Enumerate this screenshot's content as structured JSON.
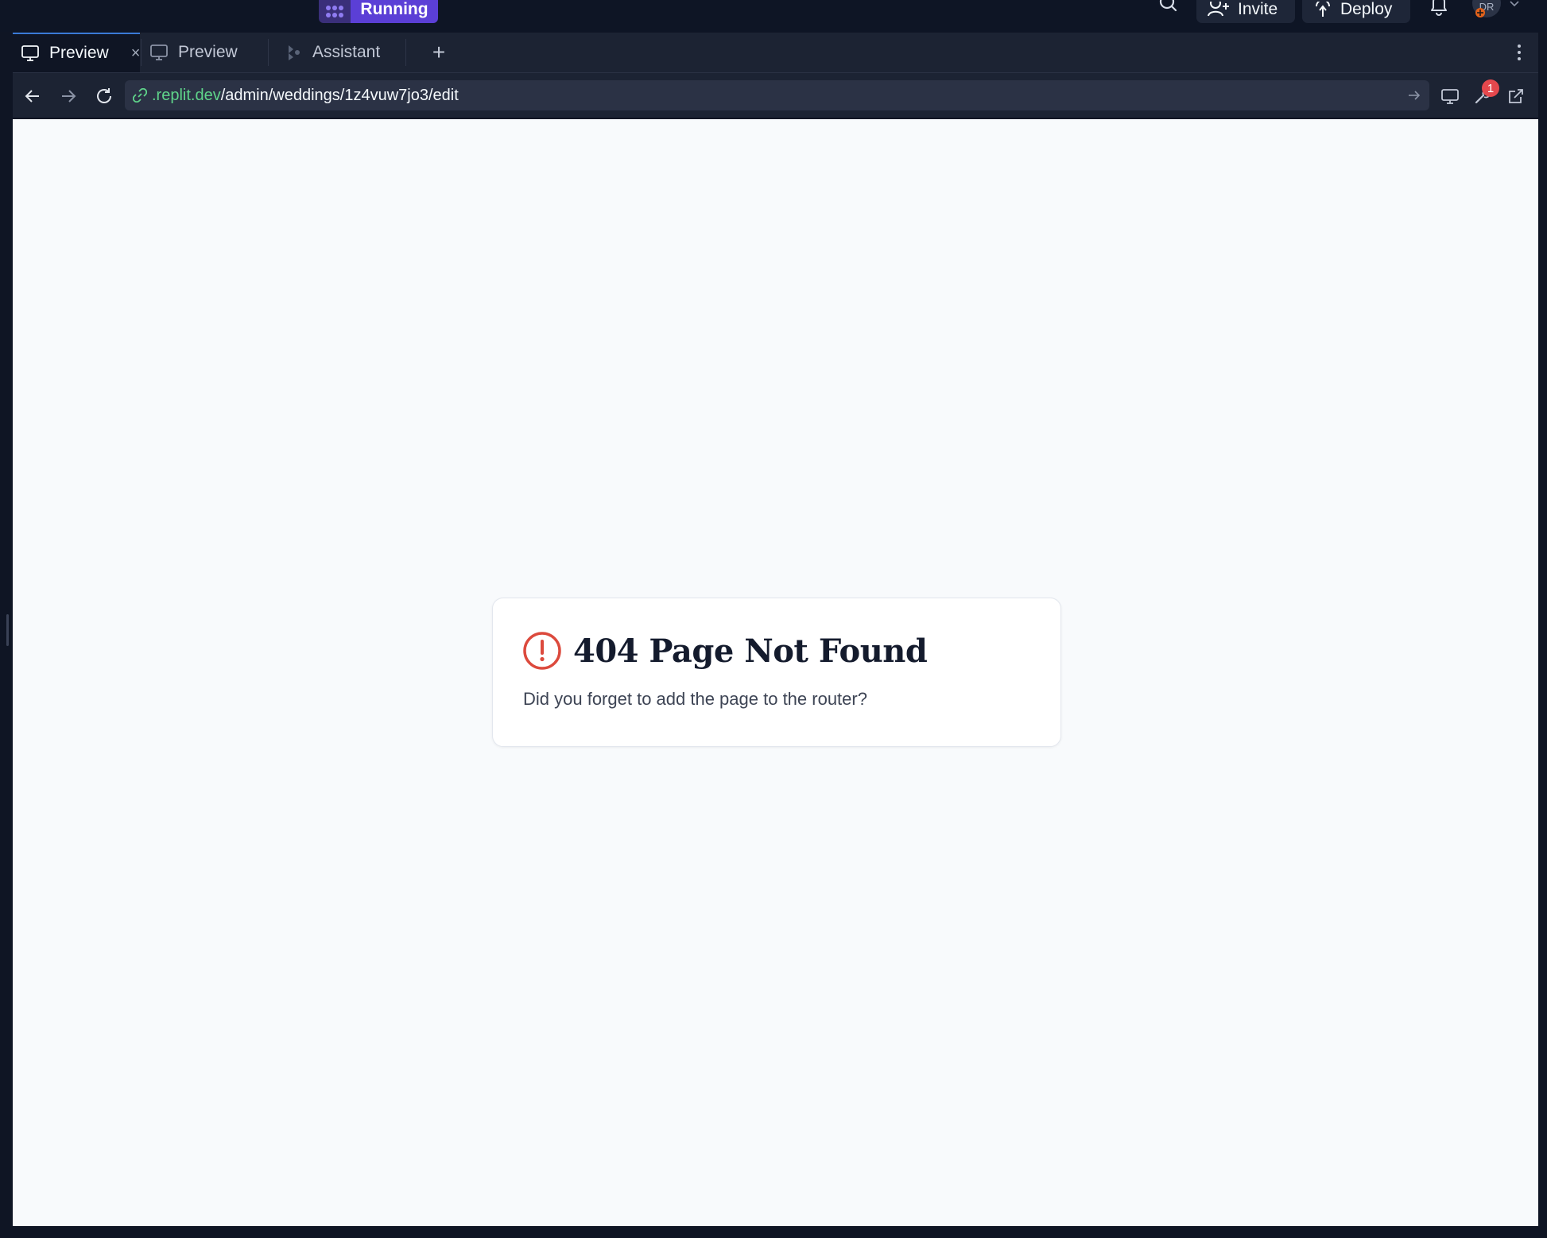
{
  "topbar": {
    "run_label": "Running",
    "invite_label": "Invite",
    "deploy_label": "Deploy",
    "avatar_initials": "DR"
  },
  "tabs": [
    {
      "label": "Preview",
      "icon": "monitor-icon",
      "active": true,
      "close": "×"
    },
    {
      "label": "Preview",
      "icon": "monitor-icon",
      "active": false
    },
    {
      "label": "Assistant",
      "icon": "assistant-icon",
      "active": false
    }
  ],
  "tab_add_label": "+",
  "address": {
    "domain": ".replit.dev",
    "path": "/admin/weddings/1z4vuw7jo3/edit"
  },
  "devtools_badge": "1",
  "page": {
    "title": "404 Page Not Found",
    "message": "Did you forget to add the page to the router?"
  },
  "colors": {
    "accent": "#5b3fd6",
    "domain": "#5fd48a",
    "error": "#dc4a3d",
    "badge": "#e5484d"
  }
}
